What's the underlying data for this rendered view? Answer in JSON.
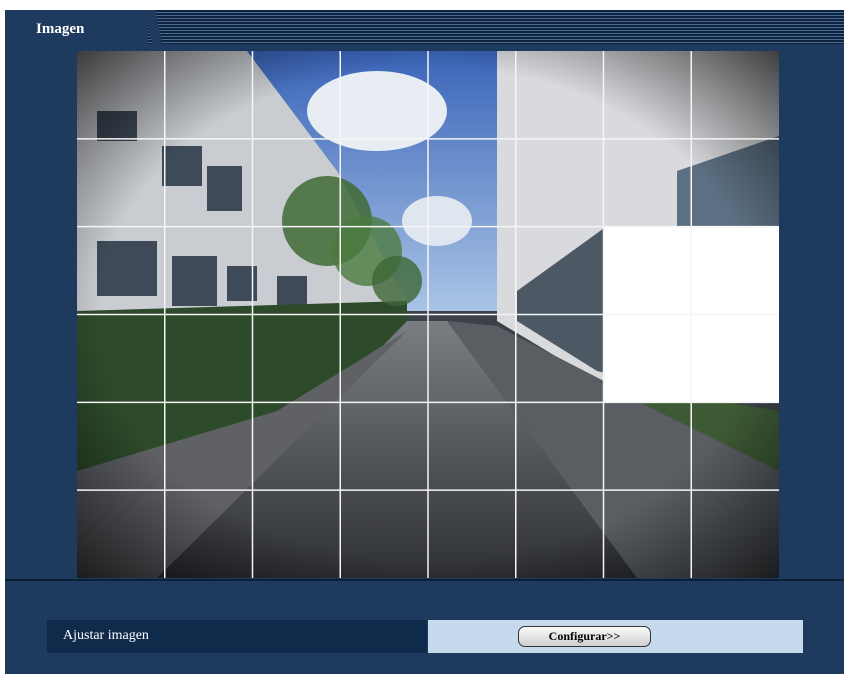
{
  "section": {
    "title": "Imagen"
  },
  "camera": {
    "grid_rows": 6,
    "grid_cols": 8,
    "masked_cells": [
      [
        2,
        6
      ],
      [
        2,
        7
      ],
      [
        3,
        6
      ],
      [
        3,
        7
      ]
    ],
    "mask_color": "#ffffff",
    "grid_line_color": "#f5f5f5"
  },
  "settings": {
    "adjust_label": "Ajustar imagen",
    "configure_button": "Configurar>>"
  },
  "colors": {
    "panel_bg": "#1e3a5e",
    "label_cell_bg": "#0f2a4a",
    "value_cell_bg": "#c7d9ec"
  }
}
